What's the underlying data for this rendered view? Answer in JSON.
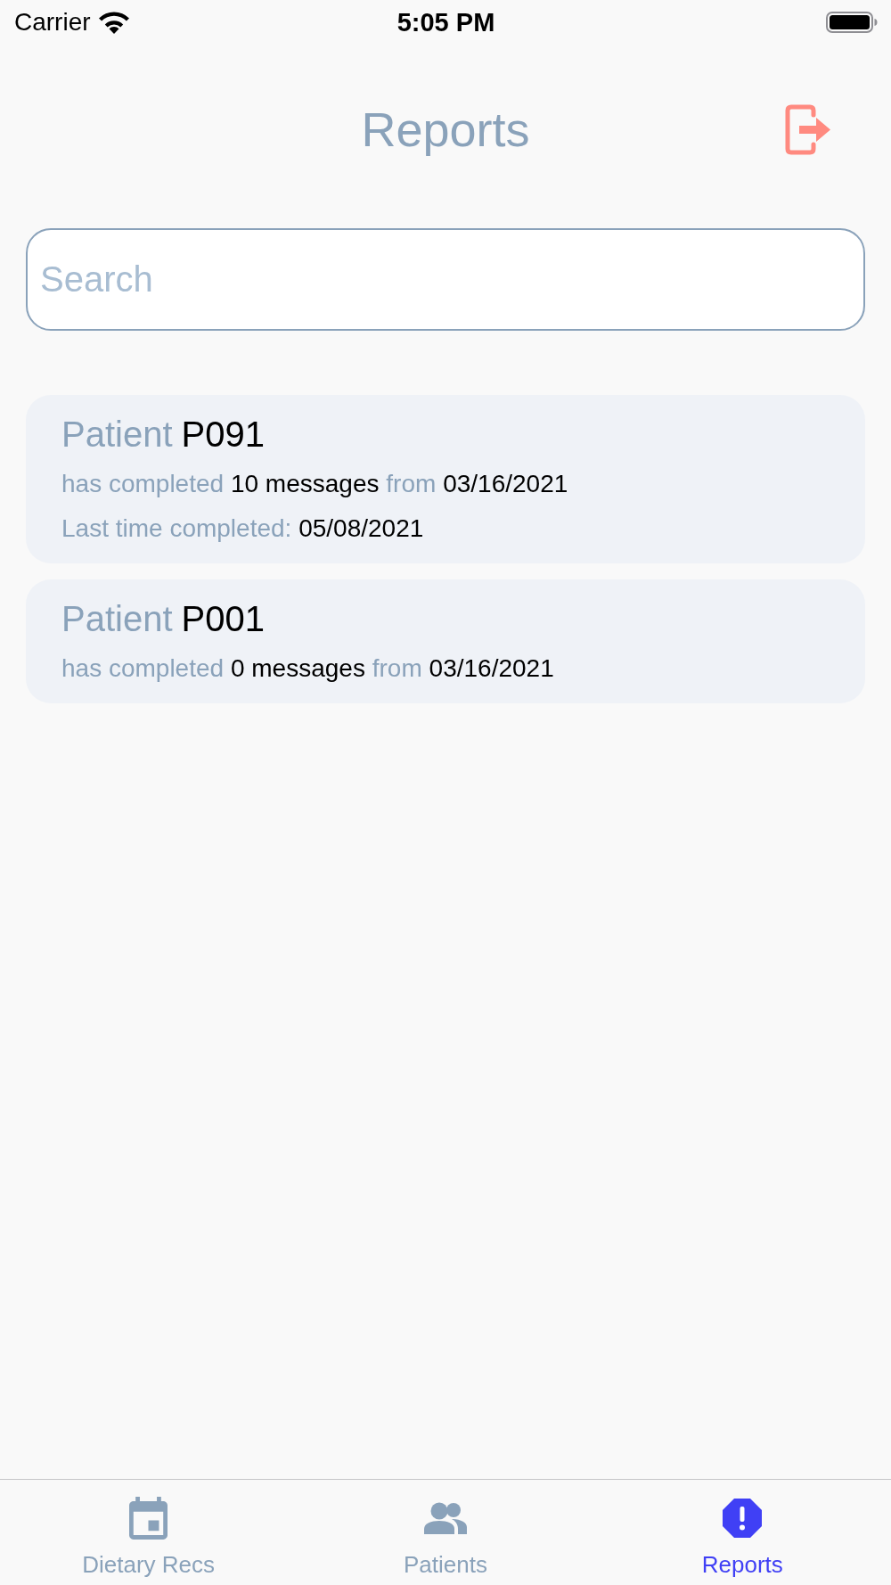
{
  "status_bar": {
    "carrier": "Carrier",
    "time": "5:05 PM"
  },
  "header": {
    "title": "Reports"
  },
  "search": {
    "placeholder": "Search"
  },
  "reports": [
    {
      "title": [
        {
          "kind": "label",
          "text": "Patient"
        },
        {
          "kind": "value",
          "text": "P091"
        }
      ],
      "lines": [
        {
          "segments": [
            {
              "kind": "label",
              "text": "has completed"
            },
            {
              "kind": "value",
              "text": "10 messages"
            },
            {
              "kind": "label",
              "text": "from"
            },
            {
              "kind": "value",
              "text": "03/16/2021"
            }
          ]
        },
        {
          "segments": [
            {
              "kind": "label",
              "text": "Last time completed:"
            },
            {
              "kind": "value",
              "text": "05/08/2021"
            }
          ]
        }
      ]
    },
    {
      "title": [
        {
          "kind": "label",
          "text": "Patient"
        },
        {
          "kind": "value",
          "text": "P001"
        }
      ],
      "lines": [
        {
          "segments": [
            {
              "kind": "label",
              "text": "has completed"
            },
            {
              "kind": "value",
              "text": "0 messages"
            },
            {
              "kind": "label",
              "text": "from"
            },
            {
              "kind": "value",
              "text": "03/16/2021"
            }
          ]
        }
      ]
    }
  ],
  "tabs": [
    {
      "label": "Dietary Recs",
      "selected": false
    },
    {
      "label": "Patients",
      "selected": false
    },
    {
      "label": "Reports",
      "selected": true
    }
  ]
}
